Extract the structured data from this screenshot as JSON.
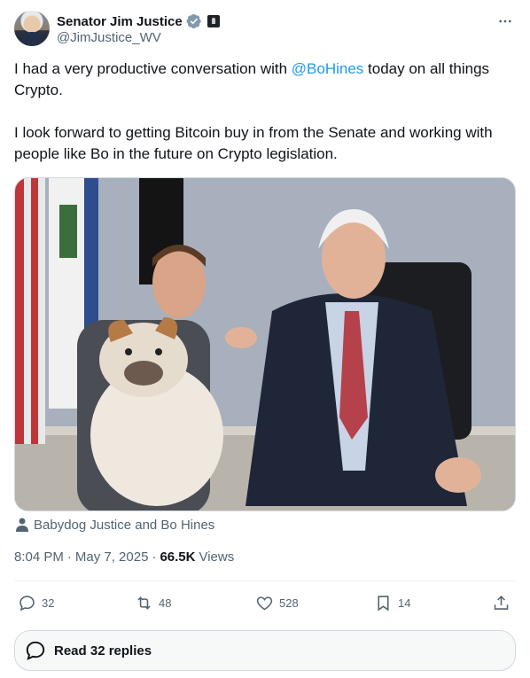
{
  "author": {
    "display_name": "Senator Jim Justice",
    "handle": "@JimJustice_WV"
  },
  "tweet": {
    "line1_before": "I had a very productive conversation with ",
    "mention": "@BoHines",
    "line1_after": " today on all things Crypto.",
    "paragraph2": "I look forward to getting Bitcoin buy in from the Senate and working with people like Bo in the future on Crypto legislation."
  },
  "media": {
    "tagged_people": "Babydog Justice and Bo Hines"
  },
  "meta": {
    "time": "8:04 PM",
    "separator": "·",
    "date": "May 7, 2025",
    "views_count": "66.5K",
    "views_label": "Views"
  },
  "actions": {
    "replies": "32",
    "reposts": "48",
    "likes": "528",
    "bookmarks": "14"
  },
  "read_replies_label": "Read 32 replies",
  "colors": {
    "accent": "#1d9bf0",
    "secondary_text": "#536471",
    "border": "#cfd9de"
  },
  "icons": [
    "verified-icon",
    "gov-badge-icon",
    "more-icon",
    "person-icon",
    "reply-icon",
    "repost-icon",
    "like-icon",
    "bookmark-icon",
    "share-icon",
    "speech-bubble-icon"
  ]
}
